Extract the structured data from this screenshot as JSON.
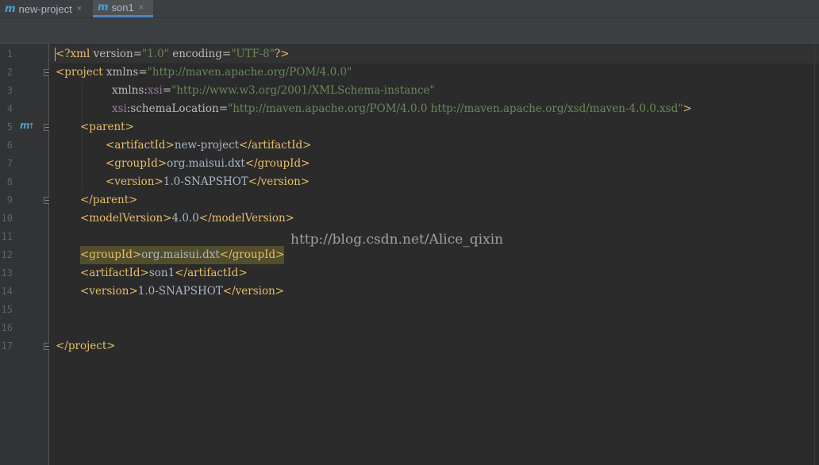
{
  "tabs": [
    {
      "icon": "m",
      "label": "new-project",
      "close": "×",
      "active": false
    },
    {
      "icon": "m",
      "label": "son1",
      "close": "×",
      "active": true
    }
  ],
  "line_numbers": [
    "1",
    "2",
    "3",
    "4",
    "5",
    "6",
    "7",
    "8",
    "9",
    "10",
    "11",
    "12",
    "13",
    "14",
    "15",
    "16",
    "17"
  ],
  "gutter_marker": {
    "icon": "maven-module-icon",
    "glyph": "m",
    "arrow": "↑"
  },
  "code": {
    "l1": {
      "open": "<?xml ",
      "a1": "version=",
      "v1": "\"1.0\"",
      "a2": " encoding=",
      "v2": "\"UTF-8\"",
      "close": "?>"
    },
    "l2": {
      "open": "<project ",
      "a1": "xmlns=",
      "v1": "\"http://maven.apache.org/POM/4.0.0\""
    },
    "l3": {
      "a1": "xmlns:",
      "ns": "xsi",
      "eq": "=",
      "v1": "\"http://www.w3.org/2001/XMLSchema-instance\""
    },
    "l4": {
      "ns": "xsi",
      "a1": ":schemaLocation=",
      "v1": "\"http://maven.apache.org/POM/4.0.0 http://maven.apache.org/xsd/maven-4.0.0.xsd\"",
      "close": ">"
    },
    "l5": {
      "tag": "<parent>"
    },
    "l6": {
      "open": "<artifactId>",
      "text": "new-project",
      "close": "</artifactId>"
    },
    "l7": {
      "open": "<groupId>",
      "text": "org.maisui.dxt",
      "close": "</groupId>"
    },
    "l8": {
      "open": "<version>",
      "text": "1.0-SNAPSHOT",
      "close": "</version>"
    },
    "l9": {
      "tag": "</parent>"
    },
    "l10": {
      "open": "<modelVersion>",
      "text": "4.0.0",
      "close": "</modelVersion>"
    },
    "l12": {
      "open": "<groupId>",
      "text": "org.maisui.dxt",
      "close": "</groupId>"
    },
    "l13": {
      "open": "<artifactId>",
      "text": "son1",
      "close": "</artifactId>"
    },
    "l14": {
      "open": "<version>",
      "text": "1.0-SNAPSHOT",
      "close": "</version>"
    },
    "l17": {
      "tag": "</project>"
    }
  },
  "watermark": "http://blog.csdn.net/Alice_qixin",
  "colors": {
    "background": "#2b2b2b",
    "gutter": "#313335",
    "tag": "#e8bf6a",
    "attribute": "#bababa",
    "value": "#6a8759",
    "namespace": "#9876aa",
    "highlight": "#524e2c",
    "tab_accent": "#4a88c7"
  }
}
